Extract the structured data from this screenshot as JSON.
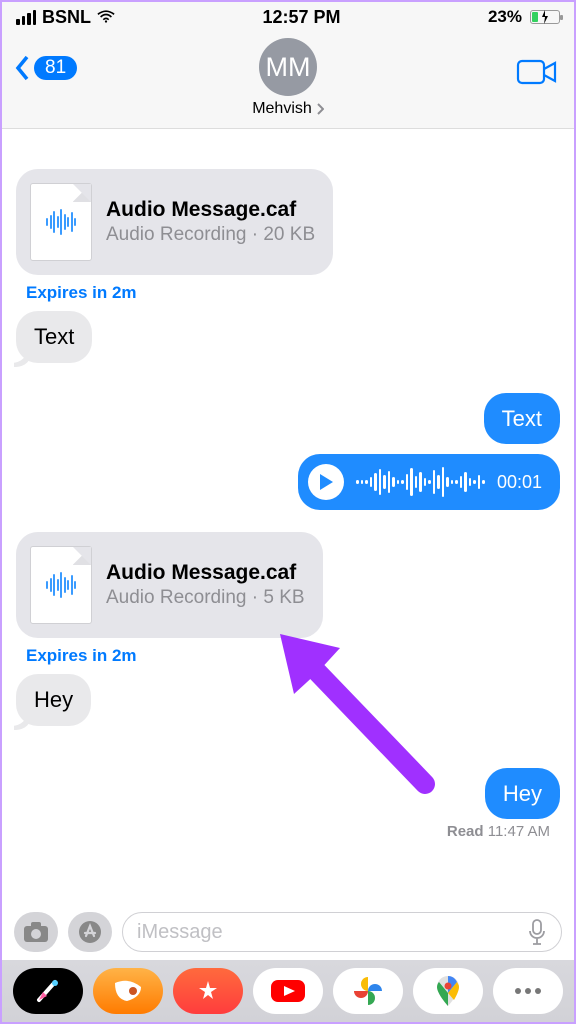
{
  "status": {
    "carrier": "BSNL",
    "time": "12:57 PM",
    "battery_pct": "23%"
  },
  "header": {
    "unread_count": "81",
    "avatar_initials": "MM",
    "contact_name": "Mehvish"
  },
  "messages": {
    "file1": {
      "name": "Audio Message.caf",
      "meta": "Audio Recording · 20 KB"
    },
    "expires1": "Expires in 2m",
    "text_in_1": "Text",
    "text_out_1": "Text",
    "audio_out_time": "00:01",
    "file2": {
      "name": "Audio Message.caf",
      "meta": "Audio Recording · 5 KB"
    },
    "expires2": "Expires in 2m",
    "text_in_2": "Hey",
    "text_out_2": "Hey",
    "receipt_label": "Read",
    "receipt_time": "11:47 AM"
  },
  "input": {
    "placeholder": "iMessage"
  },
  "colors": {
    "accent": "#007aff",
    "bubble_gray": "#e9e9eb",
    "bubble_blue": "#1f8cff",
    "arrow": "#a030ff"
  }
}
